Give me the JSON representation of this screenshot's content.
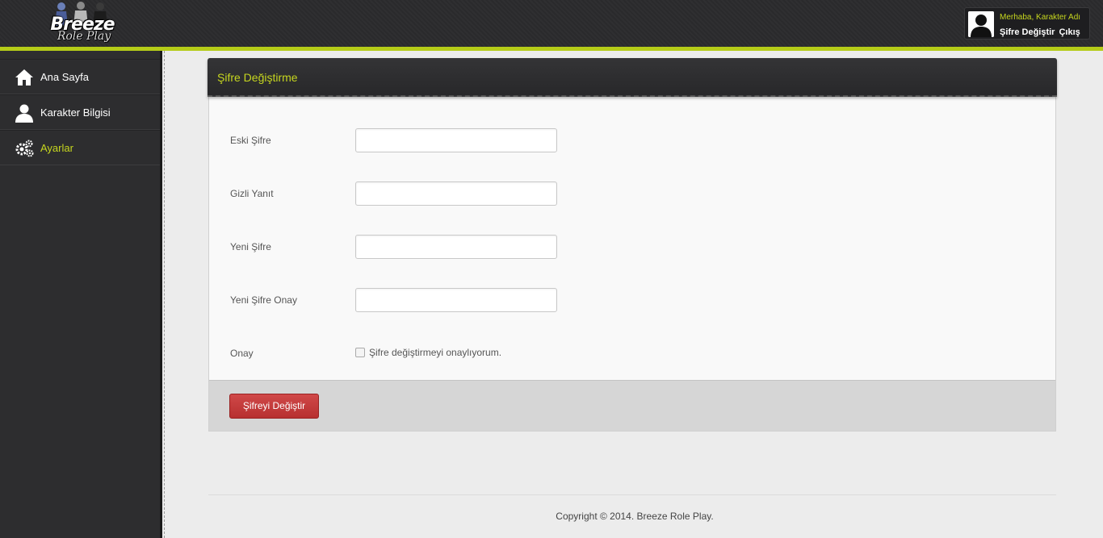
{
  "header": {
    "logo_text_line1": "Breeze",
    "logo_text_line2": "Role Play",
    "greeting": "Merhaba, Karakter Adı",
    "links": [
      "Şifre Değiştir",
      "Çıkış"
    ]
  },
  "sidebar": {
    "items": [
      {
        "label": "Ana Sayfa",
        "icon": "home-icon",
        "active": false
      },
      {
        "label": "Karakter Bilgisi",
        "icon": "user-icon",
        "active": false
      },
      {
        "label": "Ayarlar",
        "icon": "gears-icon",
        "active": true
      }
    ]
  },
  "panel": {
    "title": "Şifre Değiştirme",
    "fields": [
      {
        "label": "Eski Şifre",
        "value": ""
      },
      {
        "label": "Gizli Yanıt",
        "value": ""
      },
      {
        "label": "Yeni Şifre",
        "value": ""
      },
      {
        "label": "Yeni Şifre Onay",
        "value": ""
      }
    ],
    "confirm_label": "Onay",
    "confirm_checkbox_text": "Şifre değiştirmeyi onaylıyorum.",
    "confirm_checked": false,
    "submit_label": "Şifreyi Değiştir"
  },
  "footer": {
    "copyright": "Copyright © 2014. Breeze Role Play."
  },
  "colors": {
    "accent": "#c6d61f",
    "header_line": "#b5cc18",
    "submit": "#c23b3b",
    "sidebar_bg": "#2d2d2f"
  }
}
